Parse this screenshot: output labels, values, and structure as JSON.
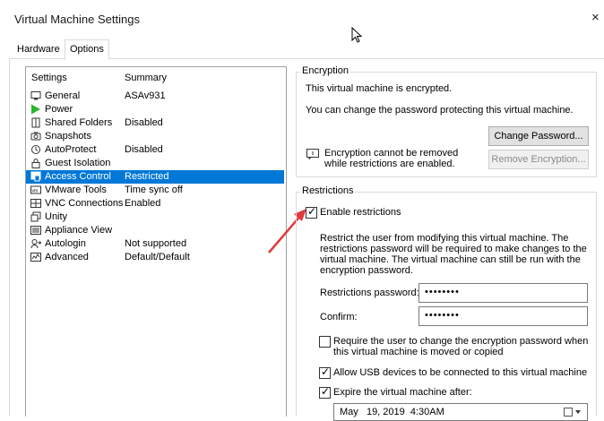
{
  "window": {
    "title": "Virtual Machine Settings",
    "close_glyph": "×"
  },
  "tabs": [
    {
      "label": "Hardware"
    },
    {
      "label": "Options"
    }
  ],
  "settings_list": {
    "col_settings": "Settings",
    "col_summary": "Summary",
    "items": [
      {
        "label": "General",
        "summary": "ASAv931",
        "icon": "general-icon"
      },
      {
        "label": "Power",
        "summary": "",
        "icon": "power-icon"
      },
      {
        "label": "Shared Folders",
        "summary": "Disabled",
        "icon": "shared-folders-icon"
      },
      {
        "label": "Snapshots",
        "summary": "",
        "icon": "snapshots-icon"
      },
      {
        "label": "AutoProtect",
        "summary": "Disabled",
        "icon": "autoprotect-icon"
      },
      {
        "label": "Guest Isolation",
        "summary": "",
        "icon": "guest-isolation-icon"
      },
      {
        "label": "Access Control",
        "summary": "Restricted",
        "icon": "access-control-icon"
      },
      {
        "label": "VMware Tools",
        "summary": "Time sync off",
        "icon": "vmware-tools-icon"
      },
      {
        "label": "VNC Connections",
        "summary": "Enabled",
        "icon": "vnc-icon"
      },
      {
        "label": "Unity",
        "summary": "",
        "icon": "unity-icon"
      },
      {
        "label": "Appliance View",
        "summary": "",
        "icon": "appliance-view-icon"
      },
      {
        "label": "Autologin",
        "summary": "Not supported",
        "icon": "autologin-icon"
      },
      {
        "label": "Advanced",
        "summary": "Default/Default",
        "icon": "advanced-icon"
      }
    ],
    "selected_index": 6
  },
  "encryption": {
    "title": "Encryption",
    "status": "This virtual machine is encrypted.",
    "change_info": "You can change the password protecting this virtual machine.",
    "change_button": "Change Password...",
    "note_line1": "Encryption cannot be removed",
    "note_line2": "while restrictions are enabled.",
    "remove_button": "Remove Encryption..."
  },
  "restrictions": {
    "title": "Restrictions",
    "enable_label": "Enable restrictions",
    "enable_checked": true,
    "desc_lines": [
      "Restrict the user from modifying this virtual machine. The",
      "restrictions password will be required to make changes to the",
      "virtual machine. The virtual machine can still be run with the",
      "encryption password."
    ],
    "password_label": "Restrictions password:",
    "password_value": "••••••••",
    "confirm_label": "Confirm:",
    "confirm_value": "••••••••",
    "require_line1": "Require the user to change the encryption password when",
    "require_line2": "this virtual machine is moved or copied",
    "require_checked": false,
    "usb_label": "Allow USB devices to be connected to this virtual machine",
    "usb_checked": true,
    "expire_label": "Expire the virtual machine after:",
    "expire_checked": true,
    "expire_value": "May   19, 2019  4:30AM"
  },
  "colors": {
    "selection": "#0078d7",
    "arrow": "#e0393e"
  }
}
